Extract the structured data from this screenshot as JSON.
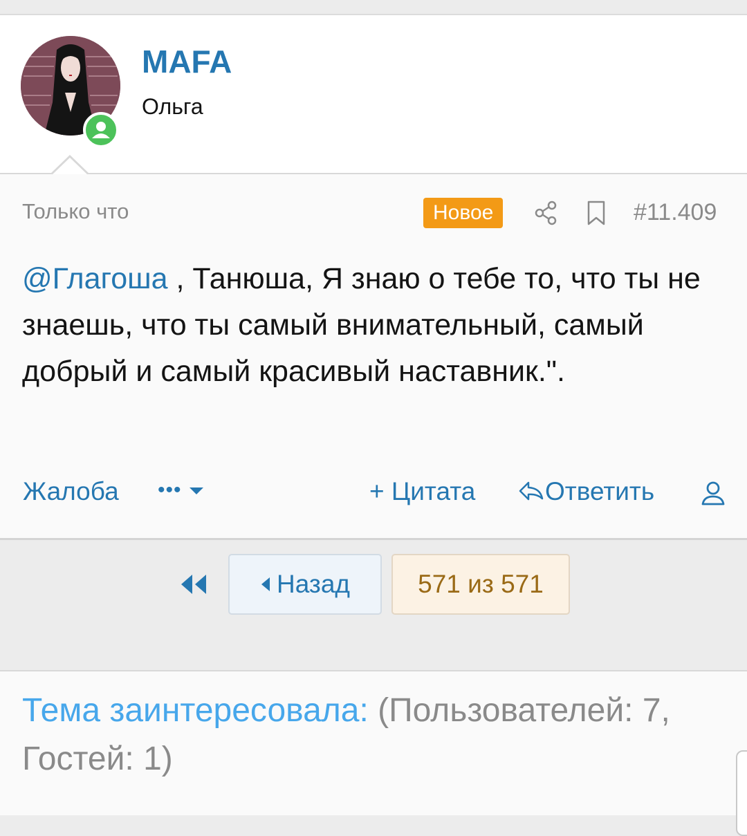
{
  "user": {
    "name": "MAFA",
    "title": "Ольга",
    "status_color": "#4cc25a"
  },
  "post": {
    "time": "Только что",
    "badge": "Новое",
    "number": "#11.409",
    "mention": "@Глагоша",
    "text": " , Танюша, Я знаю о тебе то, что ты не знаешь, что ты самый внимательный, самый добрый и самый красивый наставник.\"."
  },
  "actions": {
    "report": "Жалоба",
    "more": "•••",
    "quote": "+ Цитата",
    "reply": "Ответить"
  },
  "pager": {
    "prev": "Назад",
    "current": "571 из 571"
  },
  "interest": {
    "label": "Тема заинтересовала:",
    "counts": " (Пользователей: 7, Гостей: 1)"
  },
  "colors": {
    "accent": "#2577b1",
    "badge": "#f39a16",
    "page_text": "#9a6a16"
  }
}
